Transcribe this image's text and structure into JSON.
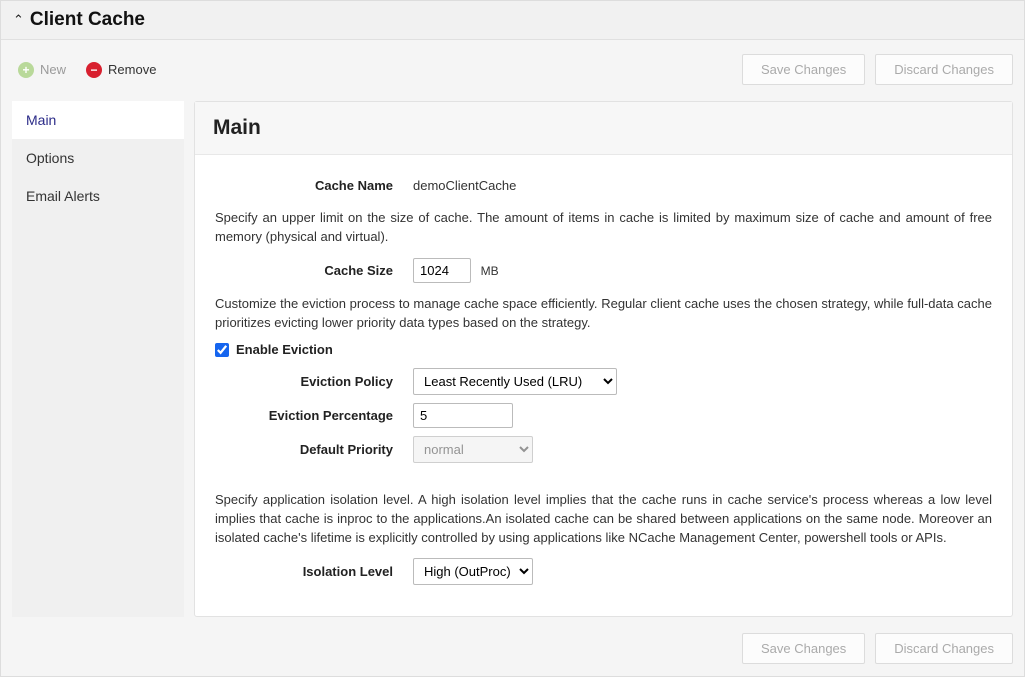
{
  "header": {
    "title": "Client Cache"
  },
  "toolbar": {
    "new_label": "New",
    "remove_label": "Remove",
    "save_label": "Save Changes",
    "discard_label": "Discard Changes"
  },
  "sidebar": {
    "items": [
      {
        "label": "Main",
        "active": true
      },
      {
        "label": "Options"
      },
      {
        "label": "Email Alerts"
      }
    ]
  },
  "main": {
    "heading": "Main",
    "cache_name_label": "Cache Name",
    "cache_name_value": "demoClientCache",
    "size_desc": "Specify an upper limit on the size of cache. The amount of items in cache is limited by maximum size of cache and amount of free memory (physical and virtual).",
    "cache_size_label": "Cache Size",
    "cache_size_value": "1024",
    "cache_size_unit": "MB",
    "eviction_desc": "Customize the eviction process to manage cache space efficiently. Regular client cache uses the chosen strategy, while full-data cache prioritizes evicting lower priority data types based on the strategy.",
    "enable_eviction_label": "Enable Eviction",
    "enable_eviction_checked": true,
    "eviction_policy_label": "Eviction Policy",
    "eviction_policy_value": "Least Recently Used (LRU)",
    "eviction_pct_label": "Eviction Percentage",
    "eviction_pct_value": "5",
    "default_priority_label": "Default Priority",
    "default_priority_value": "normal",
    "isolation_desc": "Specify application isolation level. A high isolation level implies that the cache runs in cache service's process whereas a low level implies that cache is inproc to the applications.An isolated cache can be shared between applications on the same node. Moreover an isolated cache's lifetime is explicitly controlled by using applications like NCache Management Center, powershell tools or APIs.",
    "isolation_level_label": "Isolation Level",
    "isolation_level_value": "High (OutProc)"
  }
}
